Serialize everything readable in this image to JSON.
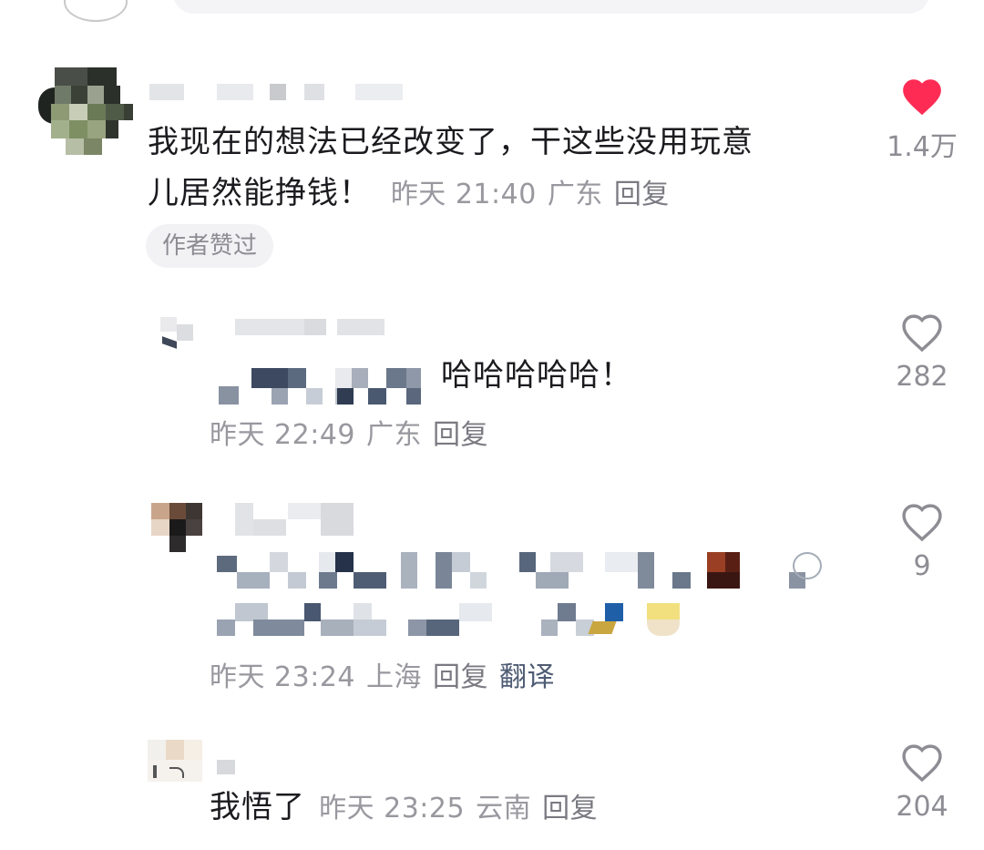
{
  "comments": [
    {
      "text_line1": "我现在的想法已经改变了，干这些没用玩意",
      "text_line2": "儿居然能挣钱！",
      "time": "昨天 21:40",
      "location": "广东",
      "reply_label": "回复",
      "author_badge": "作者赞过",
      "like_count": "1.4万",
      "liked": true,
      "like_icon": "heart-filled-icon"
    },
    {
      "text": "哈哈哈哈哈！",
      "time": "昨天 22:49",
      "location": "广东",
      "reply_label": "回复",
      "like_count": "282",
      "liked": false,
      "like_icon": "heart-outline-icon"
    },
    {
      "time": "昨天 23:24",
      "location": "上海",
      "reply_label": "回复",
      "translate_label": "翻译",
      "like_count": "9",
      "liked": false,
      "like_icon": "heart-outline-icon"
    },
    {
      "text": "我悟了",
      "time": "昨天 23:25",
      "location": "云南",
      "reply_label": "回复",
      "like_count": "204",
      "liked": false,
      "like_icon": "heart-outline-icon"
    }
  ],
  "colors": {
    "like_active": "#fe2c55",
    "like_inactive": "#8d8d94",
    "text_primary": "#1b1b1f",
    "meta_text": "#98989f",
    "translate_link": "#4e5b73"
  }
}
